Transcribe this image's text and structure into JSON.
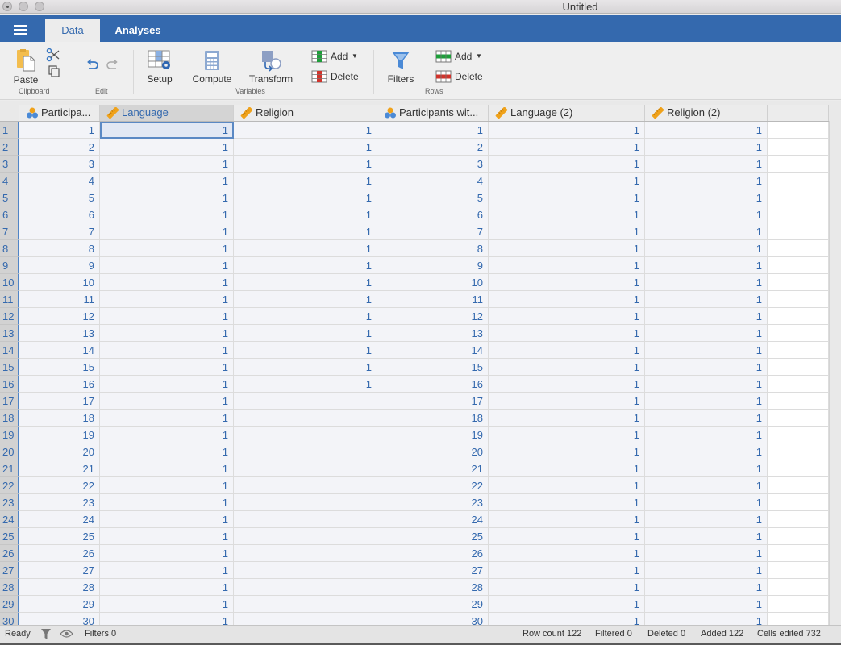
{
  "window": {
    "title": "Untitled"
  },
  "tabs": [
    {
      "label": "Data",
      "active": true
    },
    {
      "label": "Analyses",
      "active": false
    }
  ],
  "ribbon": {
    "clipboard": {
      "paste": "Paste",
      "group": "Clipboard"
    },
    "edit": {
      "group": "Edit"
    },
    "variables": {
      "setup": "Setup",
      "compute": "Compute",
      "transform": "Transform",
      "add": "Add",
      "delete": "Delete",
      "group": "Variables"
    },
    "rows": {
      "filters": "Filters",
      "add": "Add",
      "delete": "Delete",
      "group": "Rows"
    }
  },
  "colors": {
    "accent": "#3469ae",
    "add_green": "#1e9e3a",
    "delete_red": "#d0342c",
    "measure_orange": "#f0a21a"
  },
  "columns": [
    {
      "name": "Participa...",
      "type": "nominal-id"
    },
    {
      "name": "Language",
      "type": "continuous",
      "selected": true
    },
    {
      "name": "Religion",
      "type": "continuous"
    },
    {
      "name": "Participants wit...",
      "type": "nominal-id"
    },
    {
      "name": "Language (2)",
      "type": "continuous"
    },
    {
      "name": "Religion (2)",
      "type": "continuous"
    }
  ],
  "rows": [
    [
      "1",
      "1",
      "1",
      "1",
      "1",
      "1",
      "1"
    ],
    [
      "2",
      "2",
      "1",
      "1",
      "2",
      "1",
      "1"
    ],
    [
      "3",
      "3",
      "1",
      "1",
      "3",
      "1",
      "1"
    ],
    [
      "4",
      "4",
      "1",
      "1",
      "4",
      "1",
      "1"
    ],
    [
      "5",
      "5",
      "1",
      "1",
      "5",
      "1",
      "1"
    ],
    [
      "6",
      "6",
      "1",
      "1",
      "6",
      "1",
      "1"
    ],
    [
      "7",
      "7",
      "1",
      "1",
      "7",
      "1",
      "1"
    ],
    [
      "8",
      "8",
      "1",
      "1",
      "8",
      "1",
      "1"
    ],
    [
      "9",
      "9",
      "1",
      "1",
      "9",
      "1",
      "1"
    ],
    [
      "10",
      "10",
      "1",
      "1",
      "10",
      "1",
      "1"
    ],
    [
      "11",
      "11",
      "1",
      "1",
      "11",
      "1",
      "1"
    ],
    [
      "12",
      "12",
      "1",
      "1",
      "12",
      "1",
      "1"
    ],
    [
      "13",
      "13",
      "1",
      "1",
      "13",
      "1",
      "1"
    ],
    [
      "14",
      "14",
      "1",
      "1",
      "14",
      "1",
      "1"
    ],
    [
      "15",
      "15",
      "1",
      "1",
      "15",
      "1",
      "1"
    ],
    [
      "16",
      "16",
      "1",
      "1",
      "16",
      "1",
      "1"
    ],
    [
      "17",
      "17",
      "1",
      "",
      "17",
      "1",
      "1"
    ],
    [
      "18",
      "18",
      "1",
      "",
      "18",
      "1",
      "1"
    ],
    [
      "19",
      "19",
      "1",
      "",
      "19",
      "1",
      "1"
    ],
    [
      "20",
      "20",
      "1",
      "",
      "20",
      "1",
      "1"
    ],
    [
      "21",
      "21",
      "1",
      "",
      "21",
      "1",
      "1"
    ],
    [
      "22",
      "22",
      "1",
      "",
      "22",
      "1",
      "1"
    ],
    [
      "23",
      "23",
      "1",
      "",
      "23",
      "1",
      "1"
    ],
    [
      "24",
      "24",
      "1",
      "",
      "24",
      "1",
      "1"
    ],
    [
      "25",
      "25",
      "1",
      "",
      "25",
      "1",
      "1"
    ],
    [
      "26",
      "26",
      "1",
      "",
      "26",
      "1",
      "1"
    ],
    [
      "27",
      "27",
      "1",
      "",
      "27",
      "1",
      "1"
    ],
    [
      "28",
      "28",
      "1",
      "",
      "28",
      "1",
      "1"
    ],
    [
      "29",
      "29",
      "1",
      "",
      "29",
      "1",
      "1"
    ],
    [
      "30",
      "30",
      "1",
      "",
      "30",
      "1",
      "1"
    ]
  ],
  "status": {
    "ready": "Ready",
    "filters": "Filters 0",
    "row_count": "Row count 122",
    "filtered": "Filtered 0",
    "deleted": "Deleted 0",
    "added": "Added 122",
    "cells_edited": "Cells edited 732"
  }
}
